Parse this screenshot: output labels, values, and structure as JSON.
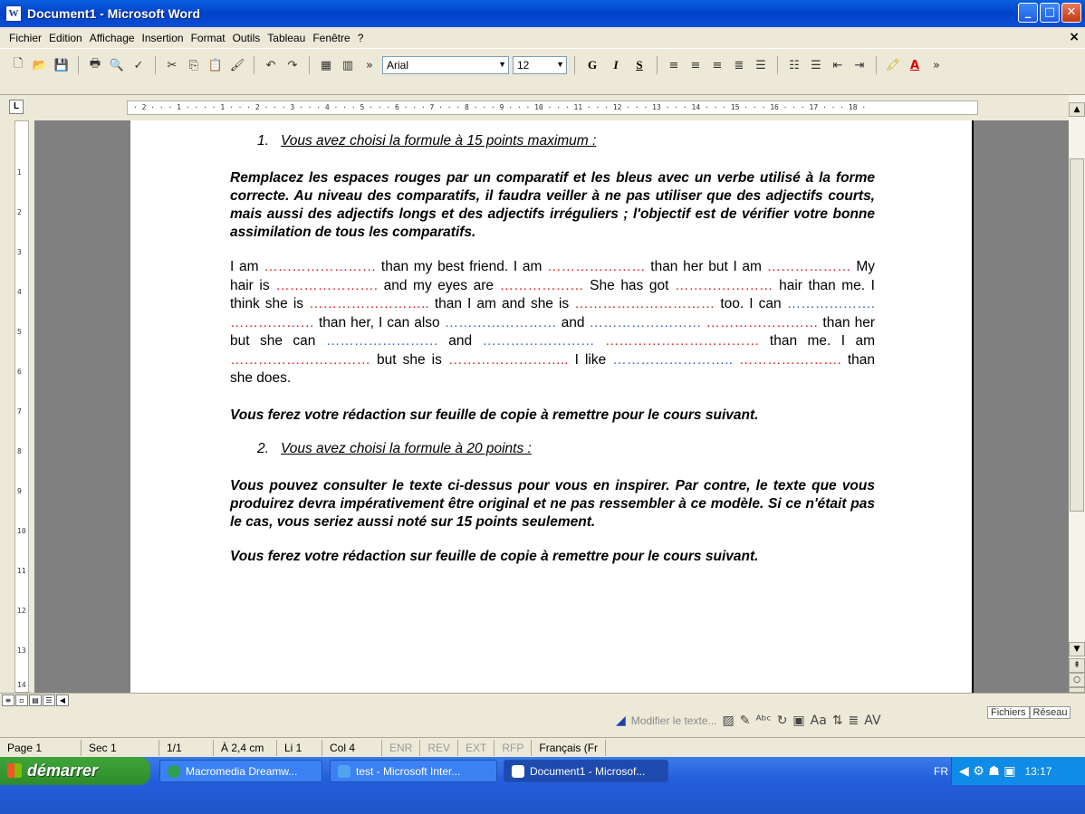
{
  "window": {
    "title": "Document1 - Microsoft Word"
  },
  "menu": [
    "Fichier",
    "Edition",
    "Affichage",
    "Insertion",
    "Format",
    "Outils",
    "Tableau",
    "Fenêtre",
    "?"
  ],
  "toolbar": {
    "font_name": "Arial",
    "font_size": "12",
    "bold": "G",
    "italic": "I",
    "underline": "S"
  },
  "ruler": {
    "text": "· 2 · · · 1 · · ·   · 1 · · · 2 · · · 3 · · · 4 · · · 5 · · · 6 · · · 7 · · · 8 · · · 9 · · · 10 · · · 11 · · · 12 · · · 13 · · · 14 · · · 15 · · · 16 · · · 17 · · · 18 ·"
  },
  "vruler": [
    "1",
    "2",
    "3",
    "4",
    "5",
    "6",
    "7",
    "8",
    "9",
    "10",
    "11",
    "12",
    "13",
    "14"
  ],
  "document": {
    "heading1_num": "1.",
    "heading1": "Vous avez choisi la formule à 15 points maximum :",
    "instructions1": "Remplacez les espaces rouges par un comparatif et les bleus avec un verbe utilisé à la forme correcte. Au niveau des comparatifs, il faudra veiller à ne pas utiliser que des adjectifs courts, mais aussi des adjectifs longs et des adjectifs irréguliers ; l'objectif est de vérifier votre bonne assimilation de tous les comparatifs.",
    "exercise": [
      {
        "t": "I am ",
        "c": ""
      },
      {
        "t": "……………………",
        "c": "r"
      },
      {
        "t": " than my best friend. I am ",
        "c": ""
      },
      {
        "t": "…………………",
        "c": "r"
      },
      {
        "t": " than her but I am ",
        "c": ""
      },
      {
        "t": "………………",
        "c": "r"
      },
      {
        "t": " My hair is ",
        "c": ""
      },
      {
        "t": "………………….",
        "c": "r"
      },
      {
        "t": " and my eyes are ",
        "c": ""
      },
      {
        "t": "………………",
        "c": "r"
      },
      {
        "t": " She has got ",
        "c": ""
      },
      {
        "t": "…………………",
        "c": "r"
      },
      {
        "t": " hair than me. I think she is ",
        "c": ""
      },
      {
        "t": "……………………..",
        "c": "r"
      },
      {
        "t": " than I am and she is ",
        "c": ""
      },
      {
        "t": "…………………………",
        "c": "r"
      },
      {
        "t": " too. I can ",
        "c": ""
      },
      {
        "t": "……………….",
        "c": "b"
      },
      {
        "t": " ",
        "c": ""
      },
      {
        "t": "………………",
        "c": "r"
      },
      {
        "t": " than her, I can also ",
        "c": ""
      },
      {
        "t": "……………………",
        "c": "b"
      },
      {
        "t": " and ",
        "c": ""
      },
      {
        "t": "……………………",
        "c": "b"
      },
      {
        "t": " ",
        "c": ""
      },
      {
        "t": "……………………",
        "c": "r"
      },
      {
        "t": " than her but she can ",
        "c": ""
      },
      {
        "t": "……………………",
        "c": "b"
      },
      {
        "t": " and ",
        "c": ""
      },
      {
        "t": "……………………",
        "c": "b"
      },
      {
        "t": " ",
        "c": ""
      },
      {
        "t": "……………………………",
        "c": "r"
      },
      {
        "t": " than me. I am ",
        "c": ""
      },
      {
        "t": "…………………………",
        "c": "r"
      },
      {
        "t": " but she is ",
        "c": ""
      },
      {
        "t": "……………………..",
        "c": "r"
      },
      {
        "t": " I like ",
        "c": ""
      },
      {
        "t": "……………………..",
        "c": "b"
      },
      {
        "t": " ",
        "c": ""
      },
      {
        "t": "………………….",
        "c": "r"
      },
      {
        "t": " than she does.",
        "c": ""
      }
    ],
    "footer1": "Vous ferez votre rédaction sur feuille de copie à remettre pour le cours suivant.",
    "heading2_num": "2.",
    "heading2": "Vous avez choisi la formule à 20 points :",
    "instructions2": "Vous pouvez consulter le texte ci-dessus pour vous en inspirer. Par contre, le texte que vous produirez devra impérativement être original et ne pas ressembler à ce modèle. Si ce n'était pas le cas, vous seriez aussi noté sur 15 points seulement.",
    "footer2": "Vous ferez votre rédaction sur feuille de copie à remettre pour le cours suivant."
  },
  "drawbar": {
    "modify_text": "Modifier le texte..."
  },
  "panel_tabs": [
    "Fichiers",
    "Réseau"
  ],
  "status": {
    "page": "Page 1",
    "sec": "Sec 1",
    "pages": "1/1",
    "position": "À 2,4 cm",
    "line": "Li 1",
    "col": "Col 4",
    "enr": "ENR",
    "rev": "REV",
    "ext": "EXT",
    "rfp": "RFP",
    "language": "Français (Fr"
  },
  "taskbar": {
    "start": "démarrer",
    "tasks": [
      "Macromedia Dreamw...",
      "test - Microsoft Inter...",
      "Document1 - Microsof..."
    ],
    "lang": "FR",
    "clock": "13:17"
  },
  "colors": {
    "blank_red": "#E02020",
    "blank_blue": "#3366D6",
    "titlebar": "#0042C8"
  }
}
